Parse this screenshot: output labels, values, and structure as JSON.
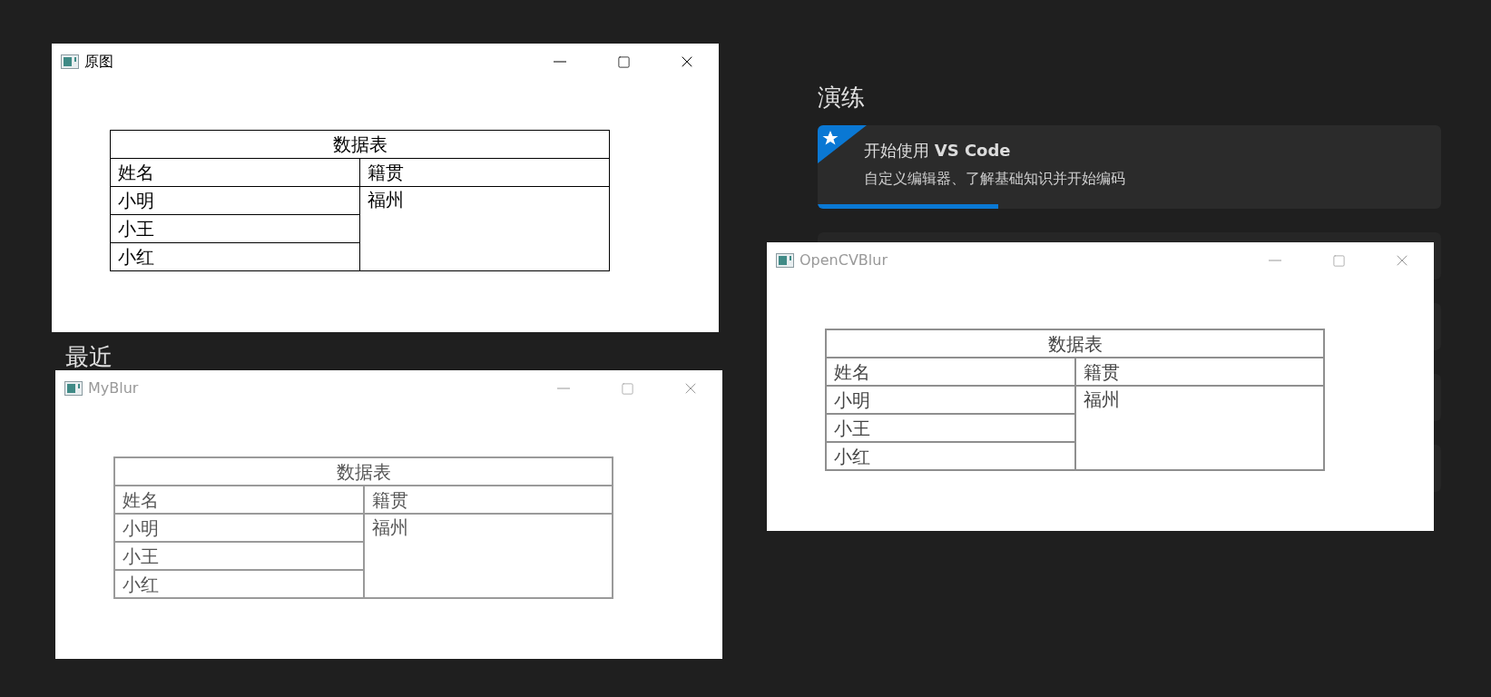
{
  "background": {
    "section_title": "演练",
    "walkthrough": {
      "title": "开始使用 **VS Code**",
      "description": "自定义编辑器、了解基础知识并开始编码",
      "level": 0.29
    },
    "recent_title": "最近"
  },
  "windows": [
    {
      "title": "原图",
      "active": true,
      "kind": "sharp",
      "table": {
        "caption": "数据表",
        "headers": [
          "姓名",
          "籍贯"
        ],
        "names": [
          "小明",
          "小王",
          "小红"
        ],
        "origin": "福州"
      }
    },
    {
      "title": "MyBlur",
      "active": false,
      "kind": "blurred",
      "table": {
        "caption": "数据表",
        "headers": [
          "姓名",
          "籍贯"
        ],
        "names": [
          "小明",
          "小王",
          "小红"
        ],
        "origin": "福州"
      }
    },
    {
      "title": "OpenCVBlur",
      "active": false,
      "kind": "soft",
      "table": {
        "caption": "数据表",
        "headers": [
          "姓名",
          "籍贯"
        ],
        "names": [
          "小明",
          "小王",
          "小红"
        ],
        "origin": "福州"
      }
    }
  ]
}
